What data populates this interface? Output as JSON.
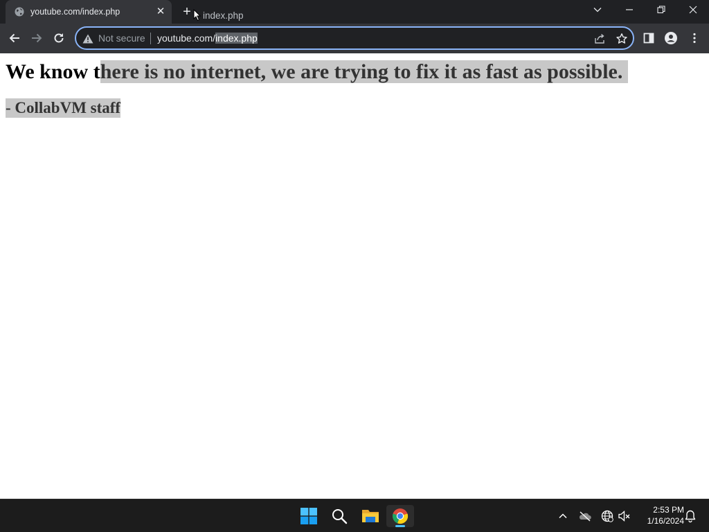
{
  "browser": {
    "tab": {
      "title": "youtube.com/index.php",
      "close_glyph": "✕"
    },
    "new_tab_glyph": "+",
    "dragged_text": "index.php",
    "omnibox": {
      "security_label": "Not secure",
      "url_host": "youtube.com/",
      "url_path_selected": "index.php"
    },
    "icons": {
      "back": "arrow-left-icon",
      "forward": "arrow-right-icon",
      "reload": "reload-icon",
      "share": "share-icon",
      "bookmark": "star-icon",
      "side_panel": "side-panel-icon",
      "profile": "profile-icon",
      "menu": "kebab-menu-icon"
    },
    "colors": {
      "omnibox_focus": "#8ab4f8",
      "tab_strip": "#202124",
      "toolbar": "#35363a"
    }
  },
  "page": {
    "heading_plain": "We know t",
    "heading_selected": "here is no internet, we are trying to fix it as fast as possible.",
    "signature": "- CollabVM staff",
    "selection_color": "#c8c8c8"
  },
  "taskbar": {
    "apps": [
      "windows-start-icon",
      "search-icon",
      "file-explorer-icon",
      "chrome-icon"
    ],
    "clock": {
      "time": "2:53 PM",
      "date": "1/16/2024"
    },
    "accent": "#4cc2ff"
  }
}
